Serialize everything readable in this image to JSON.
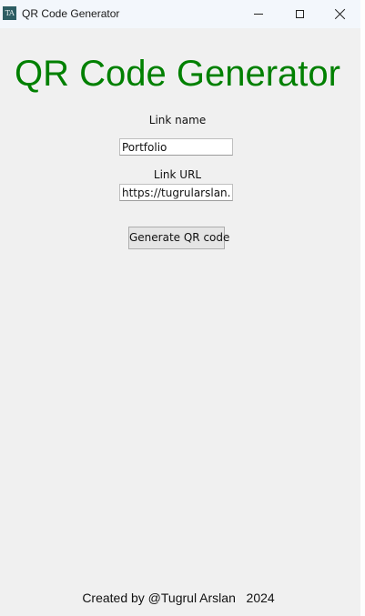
{
  "window": {
    "title": "QR Code Generator",
    "icon_name": "tk-feather-icon",
    "icon_text": "TA"
  },
  "titlebar_buttons": {
    "minimize": "minimize-icon",
    "maximize": "maximize-icon",
    "close": "close-icon"
  },
  "main": {
    "heading": "QR Code Generator",
    "heading_color": "#008000",
    "link_name_label": "Link name",
    "link_name_value": "Portfolio",
    "link_url_label": "Link URL",
    "link_url_value": "https://tugrularslan.de",
    "generate_button_label": "Generate QR code"
  },
  "footer": {
    "text": "Created by @Tugrul Arslan   2024"
  }
}
